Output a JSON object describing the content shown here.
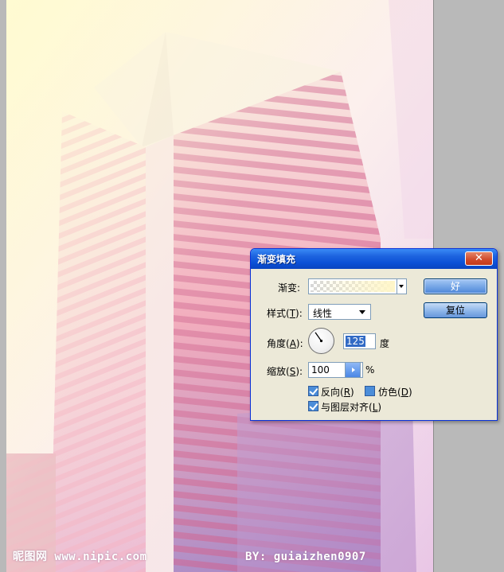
{
  "watermark": {
    "site": "昵图网 www.nipic.com",
    "author": "BY: guiaizhen0907"
  },
  "dialog": {
    "title": "渐变填充",
    "close_glyph": "✕",
    "gradient_label": "渐变:",
    "style_label_prefix": "样式(",
    "style_label_key": "T",
    "style_label_suffix": "):",
    "style_value": "线性",
    "angle_label_prefix": "角度(",
    "angle_label_key": "A",
    "angle_label_suffix": "):",
    "angle_value": "125",
    "angle_unit": "度",
    "scale_label_prefix": "缩放(",
    "scale_label_key": "S",
    "scale_label_suffix": "):",
    "scale_value": "100",
    "scale_unit": "%",
    "reverse": {
      "prefix": "反向(",
      "key": "R",
      "suffix": ")",
      "checked": true
    },
    "dither": {
      "prefix": "仿色(",
      "key": "D",
      "suffix": ")",
      "checked": false
    },
    "align": {
      "prefix": "与图层对齐(",
      "key": "L",
      "suffix": ")",
      "checked": true
    },
    "ok_label": "好",
    "reset_label": "复位"
  },
  "colors": {
    "titlebar": "#0b50d6",
    "dialog_bg": "#ece9d8",
    "gradient_end": "#fff6c8"
  }
}
